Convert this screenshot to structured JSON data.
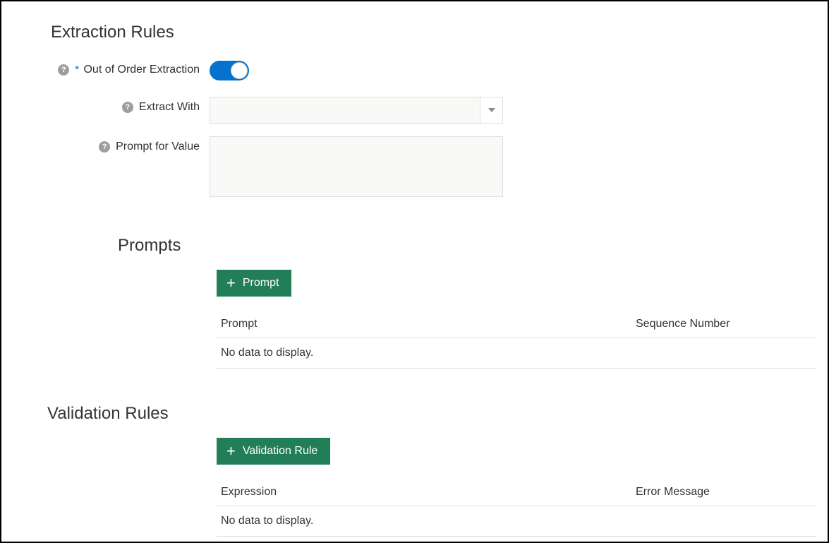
{
  "extractionRules": {
    "title": "Extraction Rules",
    "outOfOrder": {
      "label": "Out of Order Extraction",
      "required": "*",
      "value": true
    },
    "extractWith": {
      "label": "Extract With",
      "value": ""
    },
    "promptForValue": {
      "label": "Prompt for Value",
      "value": ""
    }
  },
  "prompts": {
    "title": "Prompts",
    "addButtonLabel": "Prompt",
    "columns": {
      "prompt": "Prompt",
      "sequence": "Sequence Number"
    },
    "emptyText": "No data to display."
  },
  "validationRules": {
    "title": "Validation Rules",
    "addButtonLabel": "Validation Rule",
    "columns": {
      "expression": "Expression",
      "errorMessage": "Error Message"
    },
    "emptyText": "No data to display."
  }
}
